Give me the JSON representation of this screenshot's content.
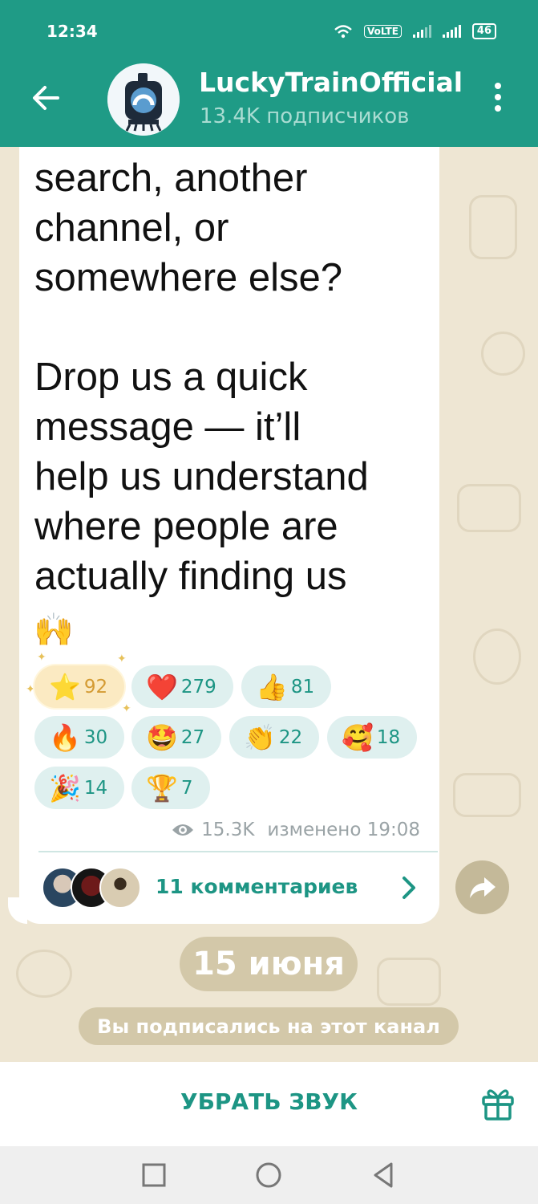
{
  "status_bar": {
    "time": "12:34",
    "volte": "VoLTE",
    "battery": "46"
  },
  "header": {
    "title": "LuckyTrainOfficial",
    "subtitle": "13.4K подписчиков"
  },
  "message": {
    "text": "search, another\nchannel, or\nsomewhere else?\n\nDrop us a quick\nmessage — it’ll\nhelp us understand\nwhere people are\nactually finding us",
    "end_emoji": "🙌",
    "reactions": [
      {
        "emoji": "⭐",
        "count": "92"
      },
      {
        "emoji": "❤️",
        "count": "279"
      },
      {
        "emoji": "👍",
        "count": "81"
      },
      {
        "emoji": "🔥",
        "count": "30"
      },
      {
        "emoji": "🤩",
        "count": "27"
      },
      {
        "emoji": "👏",
        "count": "22"
      },
      {
        "emoji": "🥰",
        "count": "18"
      },
      {
        "emoji": "🎉",
        "count": "14"
      },
      {
        "emoji": "🏆",
        "count": "7"
      }
    ],
    "views": "15.3K",
    "edited": "изменено 19:08",
    "comments_label": "11 комментариев"
  },
  "date_separator": "15 июня",
  "service_message": "Вы подписались на этот канал",
  "bottom_bar": {
    "mute_label": "УБРАТЬ ЗВУК"
  },
  "colors": {
    "accent": "#1f9b86",
    "chat_bg": "#eee6d3",
    "reaction_bg": "#dff0ef",
    "pill_bg": "#d3c8a9"
  },
  "icons": [
    "wifi-icon",
    "signal-icon",
    "battery-icon",
    "back-arrow-icon",
    "more-vert-icon",
    "eye-icon",
    "chevron-right-icon",
    "share-icon",
    "gift-icon",
    "square-nav-icon",
    "circle-nav-icon",
    "triangle-nav-icon"
  ]
}
